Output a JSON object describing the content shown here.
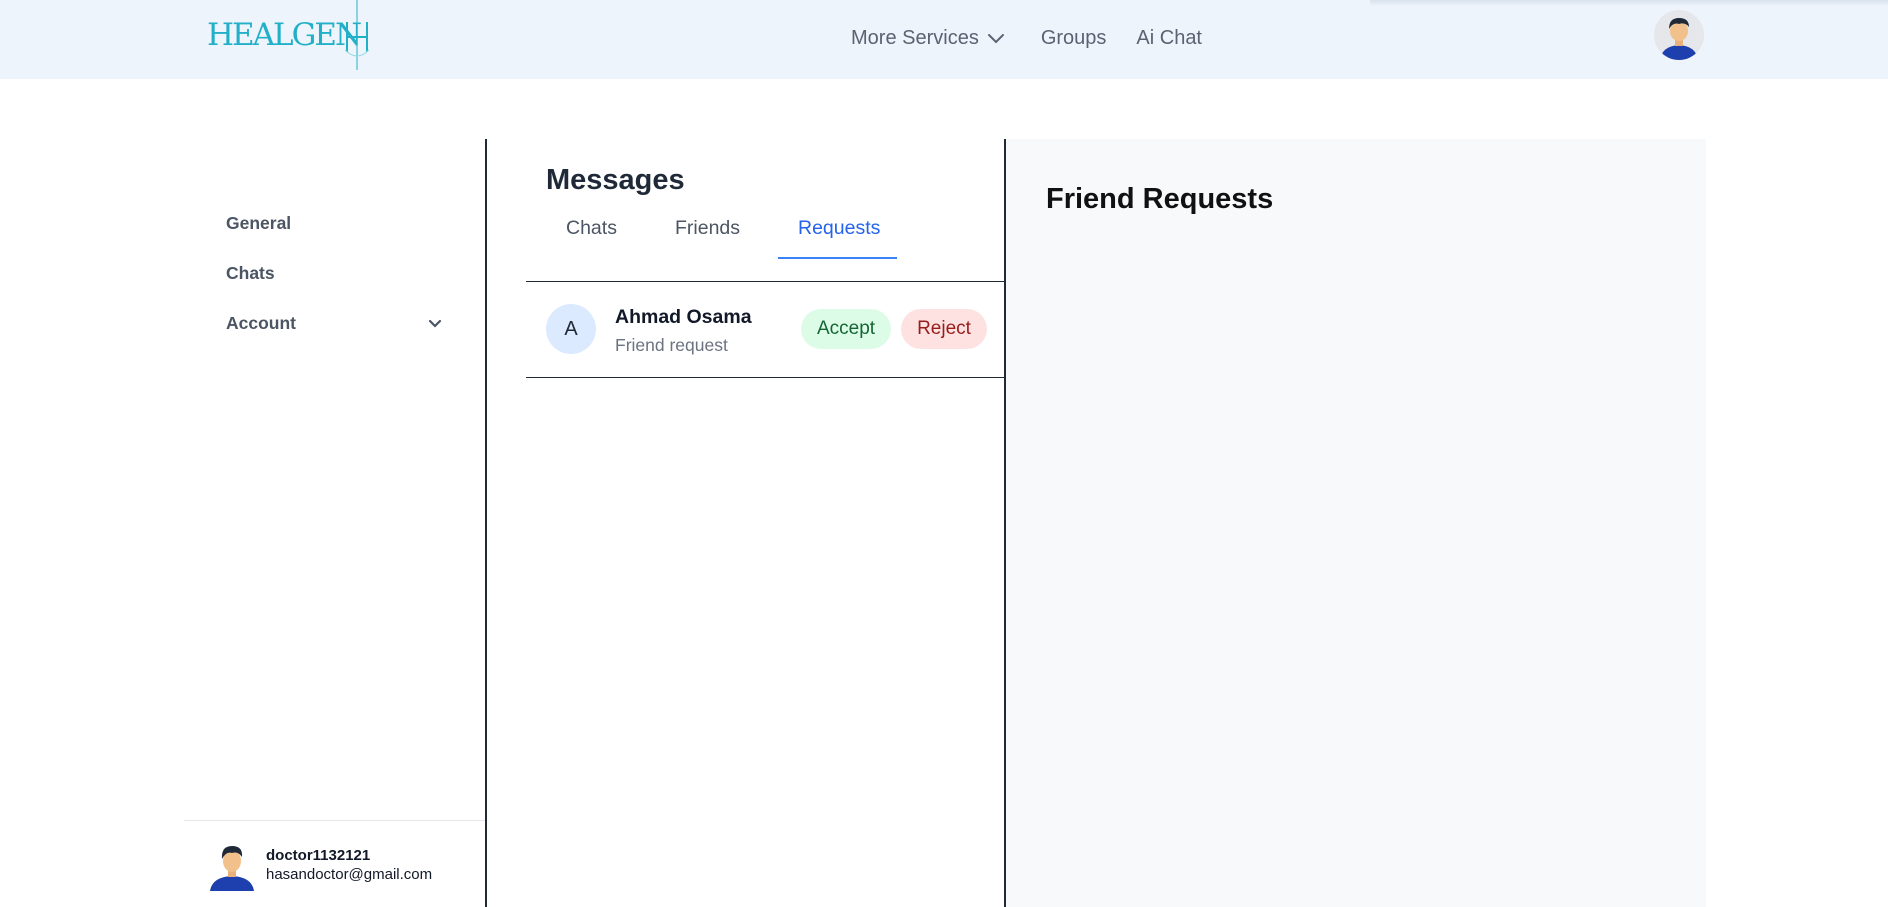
{
  "header": {
    "logo_text": "HEALGEN",
    "nav": {
      "more_services": "More Services",
      "groups": "Groups",
      "ai_chat": "Ai Chat"
    },
    "icons": {
      "dropdown": "chevron-down-icon",
      "profile": "avatar"
    }
  },
  "sidebar": {
    "items": [
      {
        "label": "General"
      },
      {
        "label": "Chats"
      },
      {
        "label": "Account",
        "icon": "chevron-down-icon"
      }
    ],
    "user": {
      "name": "doctor1132121",
      "email": "hasandoctor@gmail.com"
    }
  },
  "messages": {
    "title": "Messages",
    "tabs": [
      {
        "label": "Chats"
      },
      {
        "label": "Friends"
      },
      {
        "label": "Requests",
        "active": true
      }
    ],
    "requests": [
      {
        "initial": "A",
        "name": "Ahmad Osama",
        "subtitle": "Friend request",
        "accept_label": "Accept",
        "reject_label": "Reject"
      }
    ]
  },
  "detail": {
    "title": "Friend Requests"
  },
  "colors": {
    "header_bg": "#edf4fc",
    "accent": "#2563eb",
    "accept_bg": "#dcfce7",
    "accept_text": "#166534",
    "reject_bg": "#fee2e2",
    "reject_text": "#991b1b",
    "logo": "#22b0c8"
  }
}
